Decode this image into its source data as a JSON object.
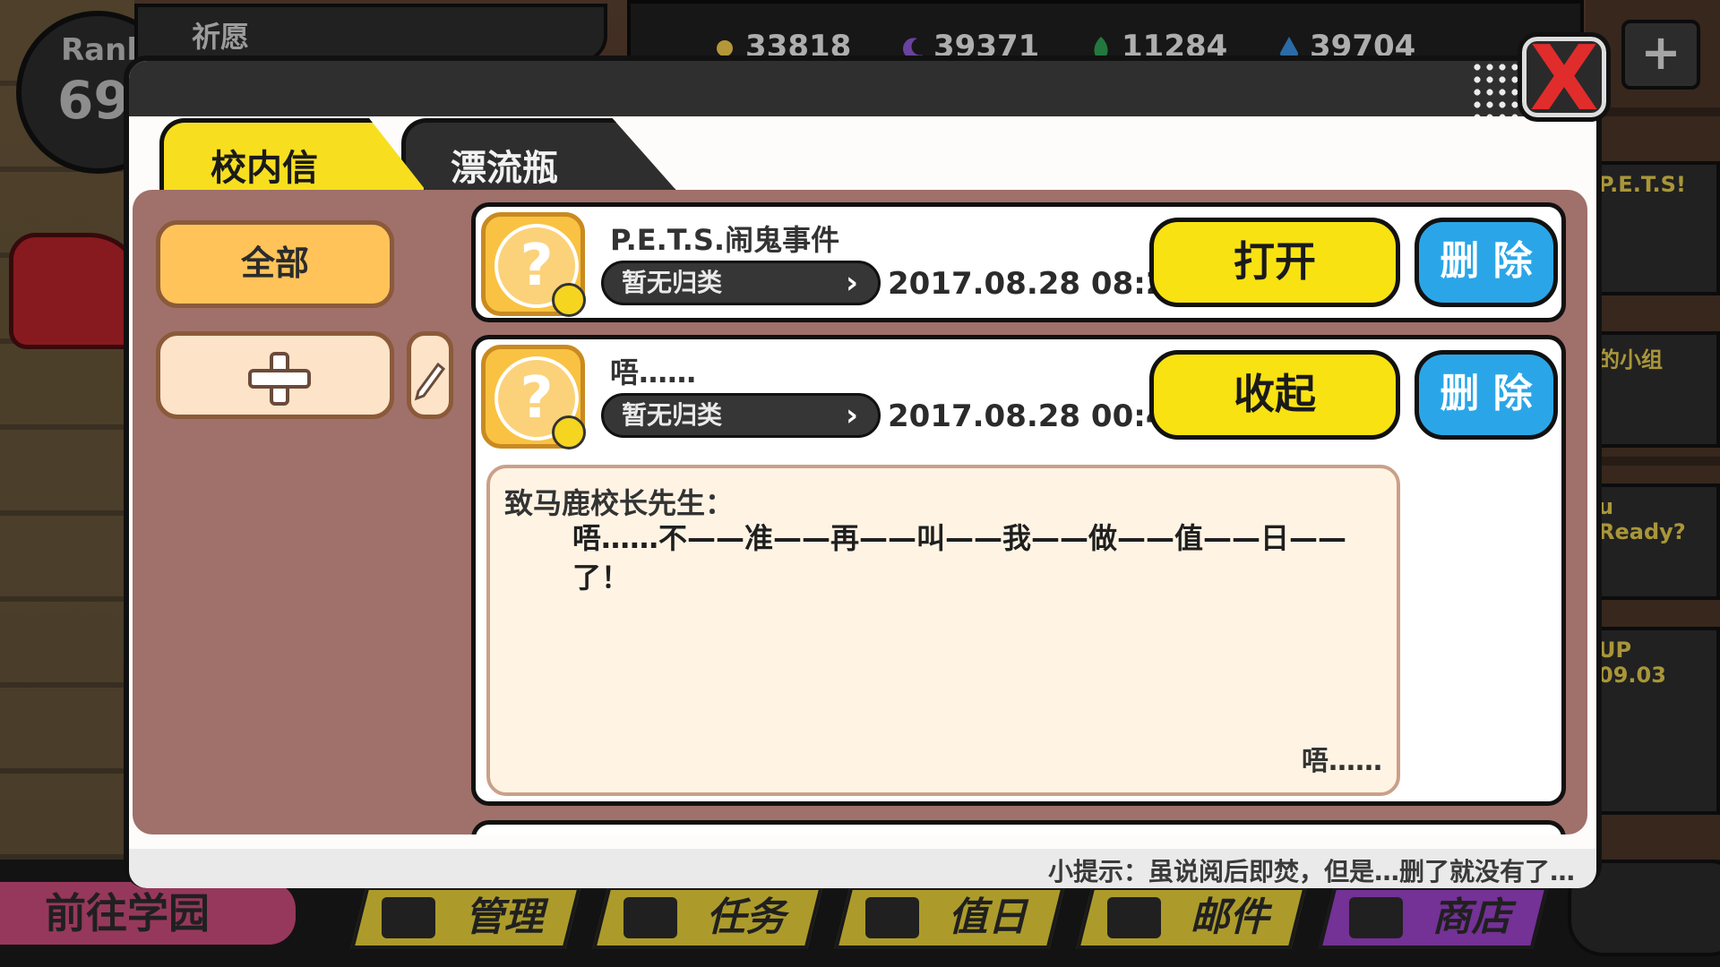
{
  "background": {
    "rank": {
      "label": "Rank",
      "value": "69"
    },
    "wish_label": "祈愿",
    "resources": [
      {
        "icon": "sun-icon",
        "value": "33818",
        "color": "#f2c84b"
      },
      {
        "icon": "moon-icon",
        "value": "39371",
        "color": "#8c5ad4"
      },
      {
        "icon": "leaf-icon",
        "value": "11284",
        "color": "#2fa052"
      },
      {
        "icon": "drop-icon",
        "value": "39704",
        "color": "#3a8fe0"
      }
    ],
    "side_cards": [
      "P.E.T.S!",
      "的小组",
      "u Ready?",
      "UP",
      "09.03"
    ],
    "bottom_nav": {
      "goto_school": "前往学园",
      "tabs": [
        "管理",
        "任务",
        "值日",
        "邮件",
        "商店"
      ]
    }
  },
  "dialog": {
    "tabs": {
      "active": "校内信",
      "inactive": "漂流瓶"
    },
    "filter_all": "全部",
    "mails": [
      {
        "title": "P.E.T.S.闹鬼事件",
        "category": "暂无归类",
        "date": "2017.08.28 08:27",
        "action": "打开",
        "delete": "删 除"
      },
      {
        "title": "唔……",
        "category": "暂无归类",
        "date": "2017.08.28 00:44",
        "action": "收起",
        "delete": "删 除",
        "letter": {
          "salutation": "致马鹿校长先生：",
          "body": "唔……不——准——再——叫——我——做——值——日——了！",
          "signature": "唔……"
        }
      }
    ],
    "hint": "小提示：虽说阅后即焚，但是…删了就没有了…",
    "colors": {
      "accent_yellow": "#f9e212",
      "delete_blue": "#2aa6e8",
      "close_red": "#e12c2c"
    }
  }
}
